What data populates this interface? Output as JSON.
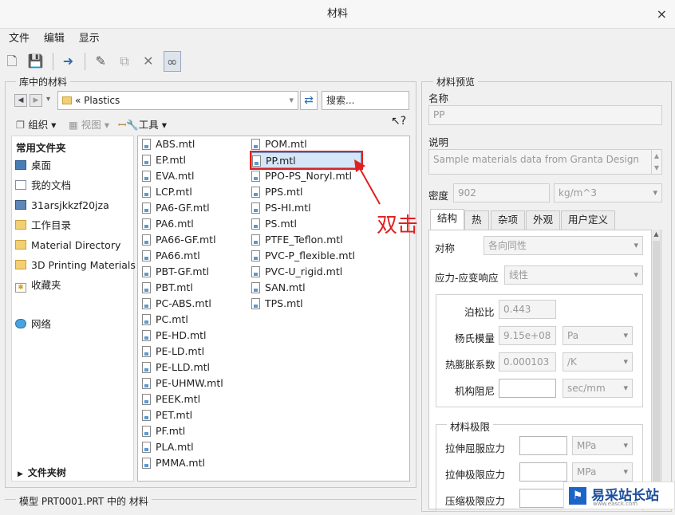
{
  "window": {
    "title": "材料",
    "close": "×"
  },
  "menu": [
    "文件",
    "编辑",
    "显示"
  ],
  "library": {
    "group_title": "库中的材料",
    "path_prefix": "«",
    "path": "Plastics",
    "search_placeholder": "搜索...",
    "organize": "组织",
    "views": "视图",
    "tools": "工具",
    "favorites_title": "常用文件夹",
    "favorites": [
      "桌面",
      "我的文档",
      "31arsjkkzf20jza",
      "工作目录",
      "Material Directory",
      "3D Printing Materials",
      "收藏夹"
    ],
    "network": "网络",
    "folder_tree": "文件夹树",
    "files_col1": [
      "ABS.mtl",
      "EP.mtl",
      "EVA.mtl",
      "LCP.mtl",
      "PA6-GF.mtl",
      "PA6.mtl",
      "PA66-GF.mtl",
      "PA66.mtl",
      "PBT-GF.mtl",
      "PBT.mtl",
      "PC-ABS.mtl",
      "PC.mtl",
      "PE-HD.mtl",
      "PE-LD.mtl",
      "PE-LLD.mtl",
      "PE-UHMW.mtl",
      "PEEK.mtl",
      "PET.mtl",
      "PF.mtl",
      "PLA.mtl",
      "PMMA.mtl"
    ],
    "files_col2": [
      "POM.mtl",
      "PP.mtl",
      "PPO-PS_Noryl.mtl",
      "PPS.mtl",
      "PS-HI.mtl",
      "PS.mtl",
      "PTFE_Teflon.mtl",
      "PVC-P_flexible.mtl",
      "PVC-U_rigid.mtl",
      "SAN.mtl",
      "TPS.mtl"
    ],
    "selected_file": "PP.mtl",
    "annotation": "双击",
    "model_group": "模型 PRT0001.PRT 中的 材料"
  },
  "preview": {
    "group_title": "材料预览",
    "name_label": "名称",
    "name_value": "PP",
    "desc_label": "说明",
    "desc_value": "Sample materials data from Granta Design",
    "density_label": "密度",
    "density_value": "902",
    "density_unit": "kg/m^3",
    "tabs": [
      "结构",
      "热",
      "杂项",
      "外观",
      "用户定义"
    ],
    "symmetry_label": "对称",
    "symmetry_value": "各向同性",
    "stress_label": "应力-应变响应",
    "stress_value": "线性",
    "poisson_label": "泊松比",
    "poisson_value": "0.443",
    "young_label": "杨氏模量",
    "young_value": "9.15e+08",
    "young_unit": "Pa",
    "thermal_label": "热膨胀系数",
    "thermal_value": "0.000103",
    "thermal_unit": "/K",
    "damping_label": "机构阻尼",
    "damping_value": "",
    "damping_unit": "sec/mm",
    "limits_title": "材料极限",
    "tensile_yield_label": "拉伸屈服应力",
    "tensile_ult_label": "拉伸极限应力",
    "compress_label": "压缩极限应力",
    "stress_unit": "MPa"
  },
  "watermark": {
    "text": "易采站长站",
    "sub": "www.easck.com"
  },
  "colors": {
    "selection": "#d4e6f7",
    "annotation": "#e02020"
  }
}
